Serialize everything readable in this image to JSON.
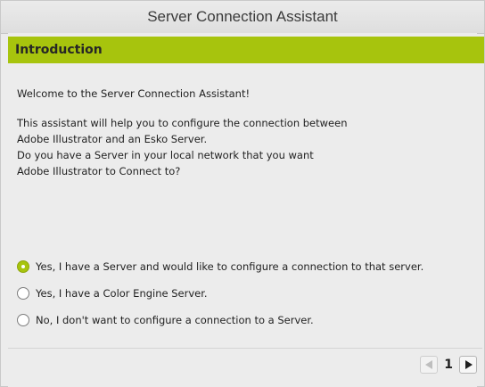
{
  "window": {
    "title": "Server Connection Assistant"
  },
  "section": {
    "title": "Introduction"
  },
  "intro": {
    "welcome": "Welcome to the Server Connection Assistant!",
    "lines": [
      "This assistant will help you to configure the connection between",
      "Adobe Illustrator and an Esko Server.",
      "Do you have a Server in your local network that you want",
      "Adobe Illustrator to Connect to?"
    ]
  },
  "options": [
    {
      "label": "Yes, I have a Server and would like to configure a connection to that server.",
      "selected": true
    },
    {
      "label": "Yes, I have a Color Engine Server.",
      "selected": false
    },
    {
      "label": "No, I don't want to configure a connection to a Server.",
      "selected": false
    }
  ],
  "pager": {
    "page": "1",
    "prev_icon": "left-arrow-icon",
    "next_icon": "right-arrow-icon"
  },
  "colors": {
    "accent": "#a7c40d",
    "background": "#ececec"
  }
}
